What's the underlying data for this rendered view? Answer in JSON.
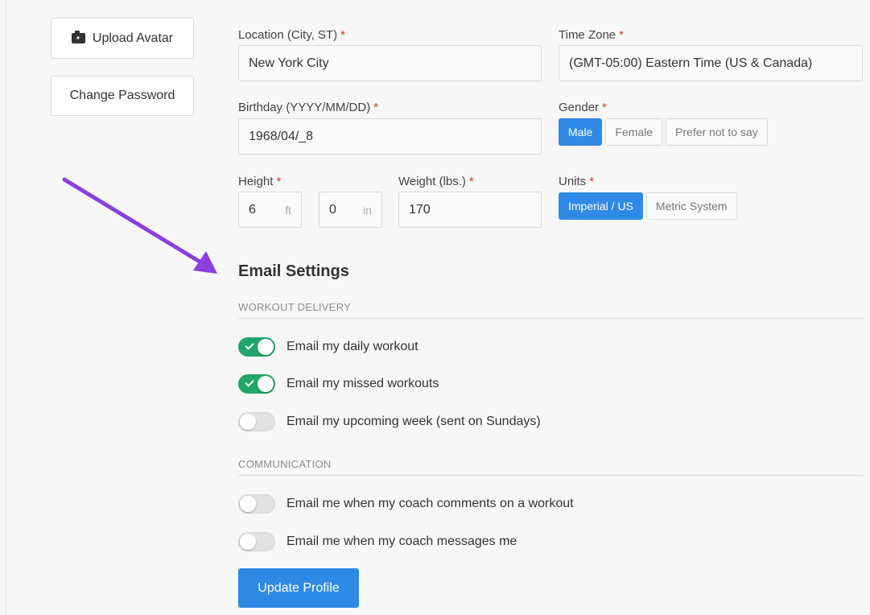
{
  "sidebar": {
    "upload_avatar": "Upload Avatar",
    "change_password": "Change Password"
  },
  "profile": {
    "location": {
      "label": "Location (City, ST)",
      "required": "*",
      "value": "New York City"
    },
    "time_zone": {
      "label": "Time Zone",
      "required": "*",
      "value": "(GMT-05:00) Eastern Time (US & Canada)"
    },
    "birthday": {
      "label": "Birthday (YYYY/MM/DD)",
      "required": "*",
      "value": "1968/04/_8"
    },
    "gender": {
      "label": "Gender",
      "required": "*",
      "options": [
        "Male",
        "Female",
        "Prefer not to say"
      ],
      "selected": "Male"
    },
    "height": {
      "label": "Height",
      "required": "*",
      "feet": "6",
      "feet_unit": "ft",
      "inches": "0",
      "inches_unit": "in"
    },
    "weight": {
      "label": "Weight (lbs.)",
      "required": "*",
      "value": "170"
    },
    "units": {
      "label": "Units",
      "required": "*",
      "options": [
        "Imperial / US",
        "Metric System"
      ],
      "selected": "Imperial / US"
    }
  },
  "email_settings": {
    "title": "Email Settings",
    "workout_delivery": {
      "heading": "WORKOUT DELIVERY",
      "toggles": [
        {
          "label": "Email my daily workout",
          "on": true
        },
        {
          "label": "Email my missed workouts",
          "on": true
        },
        {
          "label": "Email my upcoming week (sent on Sundays)",
          "on": false
        }
      ]
    },
    "communication": {
      "heading": "COMMUNICATION",
      "toggles": [
        {
          "label": "Email me when my coach comments on a workout",
          "on": false
        },
        {
          "label": "Email me when my coach messages me",
          "on": false
        }
      ]
    }
  },
  "actions": {
    "update_profile": "Update Profile"
  },
  "colors": {
    "primary": "#2f8ae5",
    "toggle_on": "#21a66a",
    "arrow": "#8a3fe0",
    "required": "#e0312f"
  }
}
